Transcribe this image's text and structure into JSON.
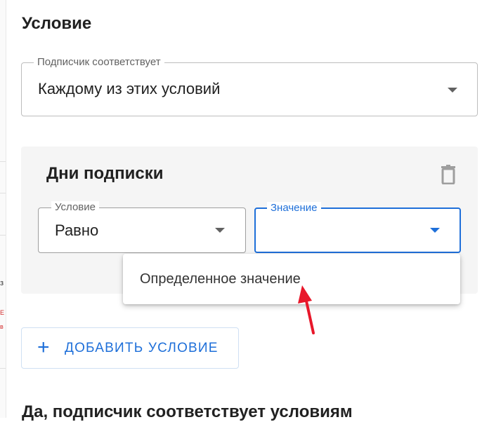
{
  "section": {
    "title": "Условие"
  },
  "match_select": {
    "legend": "Подписчик соответствует",
    "value": "Каждому из этих условий"
  },
  "condition_card": {
    "title": "Дни подписки",
    "condition_select": {
      "legend": "Условие",
      "value": "Равно"
    },
    "value_select": {
      "legend": "Значение",
      "value": ""
    }
  },
  "dropdown_menu": {
    "items": [
      "Определенное значение"
    ]
  },
  "add_condition_button": {
    "label": "ДОБАВИТЬ УСЛОВИЕ"
  },
  "bottom_heading": "Да, подписчик соответствует условиям",
  "left_strip": {
    "fragments": [
      "з",
      "E",
      "в"
    ]
  },
  "colors": {
    "accent": "#1e6fd9",
    "annotation_arrow": "#e8172a",
    "card_background": "#f5f5f5",
    "border": "#bdbdbd"
  },
  "icons": {
    "dropdown": "caret-down-icon",
    "delete": "trash-icon",
    "add": "plus-icon",
    "annotation": "red-arrow-icon"
  }
}
